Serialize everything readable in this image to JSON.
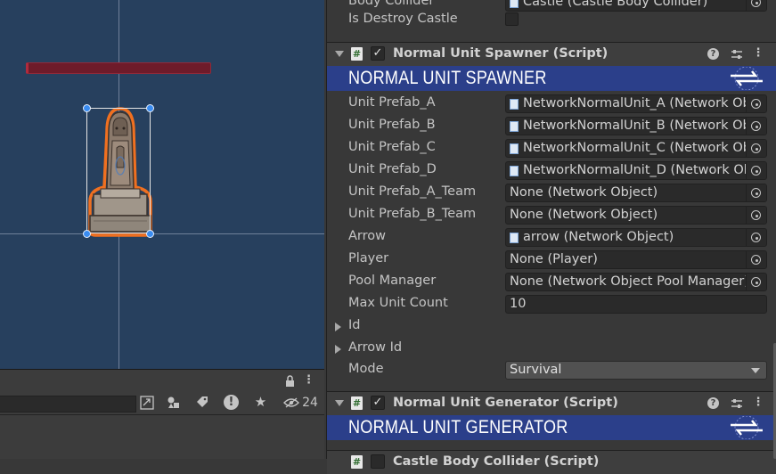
{
  "scene": {
    "show_health_bar": true
  },
  "hierarchy_toolbar": {
    "hidden_count": "24"
  },
  "inspector": {
    "top_rows": [
      {
        "label": "Body Collider",
        "value": "Castle (Castle Body Collider)"
      },
      {
        "label": "Is Destroy Castle",
        "checked": false
      }
    ],
    "components": [
      {
        "title": "Normal Unit Spawner (Script)",
        "banner": "NORMAL UNIT SPAWNER",
        "enabled": true,
        "fields": [
          {
            "label": "Unit Prefab_A",
            "value": "NetworkNormalUnit_A (Network Object)",
            "asset": true
          },
          {
            "label": "Unit Prefab_B",
            "value": "NetworkNormalUnit_B (Network Object)",
            "asset": true
          },
          {
            "label": "Unit Prefab_C",
            "value": "NetworkNormalUnit_C (Network Object)",
            "asset": true
          },
          {
            "label": "Unit Prefab_D",
            "value": "NetworkNormalUnit_D (Network Object)",
            "asset": true
          },
          {
            "label": "Unit Prefab_A_Team",
            "value": "None (Network Object)",
            "asset": false
          },
          {
            "label": "Unit Prefab_B_Team",
            "value": "None (Network Object)",
            "asset": false
          },
          {
            "label": "Arrow",
            "value": "arrow (Network Object)",
            "asset": true
          },
          {
            "label": "Player",
            "value": "None (Player)",
            "asset": false
          },
          {
            "label": "Pool Manager",
            "value": "None (Network Object Pool Manager)",
            "asset": false
          }
        ],
        "max_unit_count": {
          "label": "Max Unit Count",
          "value": "10"
        },
        "foldouts": [
          "Id",
          "Arrow Id"
        ],
        "mode": {
          "label": "Mode",
          "value": "Survival"
        }
      },
      {
        "title": "Normal Unit Generator (Script)",
        "banner": "NORMAL UNIT GENERATOR",
        "enabled": true
      }
    ],
    "next_component_title": "Castle Body Collider (Script)"
  },
  "colors": {
    "scene_bg": "#27405e",
    "banner_bg": "#2b3f8a",
    "selection_outline": "#f07020",
    "handle": "#3a8cf0",
    "health_bar": "#6e1b2a"
  },
  "icons": [
    "lock-icon",
    "kebab-menu-icon",
    "scene-visibility-icon",
    "layers-icon",
    "tag-icon",
    "error-icon",
    "favorite-star-icon",
    "hidden-objects-icon",
    "script-icon",
    "help-icon",
    "preset-icon",
    "object-picker-icon"
  ]
}
